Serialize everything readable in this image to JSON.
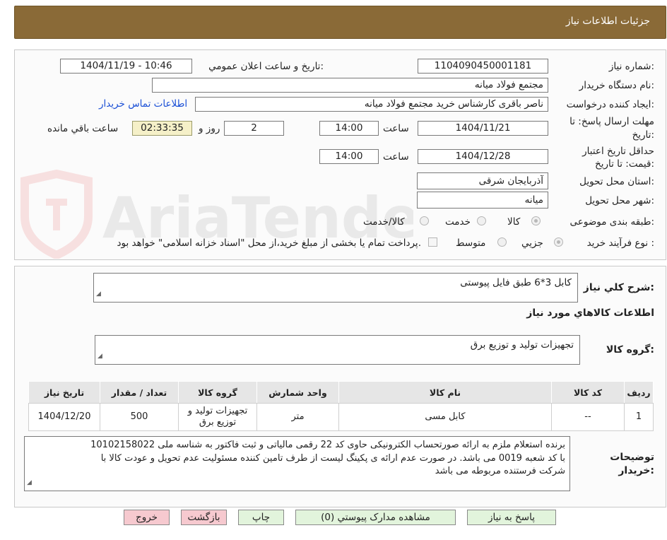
{
  "header": {
    "title": "جزئیات اطلاعات نیاز"
  },
  "watermark": {
    "text": "AriaTender.neT"
  },
  "form": {
    "need_number_label": "شماره نیاز:",
    "need_number": "1104090450001181",
    "announce_label": "تاریخ و ساعت اعلان عمومي:",
    "announce_value": "1404/11/19 - 10:46",
    "buyer_org_label": "نام دستگاه خریدار:",
    "buyer_org": "مجتمع فولاد میانه",
    "requester_label": "ایجاد کننده درخواست:",
    "requester": "ناصر باقری کارشناس خرید مجتمع فولاد میانه",
    "contact_link": "اطلاعات تماس خریدار",
    "deadline_label_1": "مهلت ارسال پاسخ: تا",
    "deadline_label_2": "تاریخ:",
    "deadline_date": "1404/11/21",
    "time_label": "ساعت",
    "deadline_time": "14:00",
    "days_value": "2",
    "days_label": "روز و",
    "timer_value": "02:33:35",
    "remaining_label": "ساعت باقي مانده",
    "validity_label_1": "حداقل تاریخ اعتبار",
    "validity_label_2": "قیمت: تا تاریخ:",
    "validity_date": "1404/12/28",
    "validity_time_label": "ساعت",
    "validity_time": "14:00",
    "province_label": "استان محل تحویل:",
    "province": "آذربایجان شرقی",
    "city_label": "شهر محل تحویل:",
    "city": "میانه",
    "category_label": "طبقه بندی موضوعی:",
    "category_options": [
      "کالا",
      "خدمت",
      "کالا/خدمت"
    ],
    "process_label": "نوع فرآیند خرید :",
    "process_options": [
      "جزیي",
      "متوسط"
    ],
    "payment_note": "پرداخت تمام یا بخشی از مبلغ خرید،از محل \"اسناد خزانه اسلامی\" خواهد بود."
  },
  "summary": {
    "label": "شرح کلي نیاز:",
    "value": "کابل 3*6 طبق فایل پیوستی"
  },
  "goods": {
    "section_title": "اطلاعات کالاهاي مورد نیاز",
    "group_label": "گروه کالا:",
    "group_value": "تجهیزات تولید و توزیع برق"
  },
  "table": {
    "headers": [
      "ردیف",
      "کد کالا",
      "نام کالا",
      "واحد شمارش",
      "گروه کالا",
      "تعداد / مقدار",
      "تاریخ نیاز"
    ],
    "rows": [
      [
        "1",
        "--",
        "کابل مسی",
        "متر",
        "تجهیزات تولید و توزیع برق",
        "500",
        "1404/12/20"
      ]
    ]
  },
  "buyer_notes": {
    "label_1": "توضیحات",
    "label_2": "خریدار:",
    "line_1": "برنده استعلام ملزم به ارائه صورتحساب الکترونیکی حاوی کد 22 رقمی مالیاتی و ثبت فاکتور به شناسه ملی 10102158022",
    "line_2": "با کد شعبه 0019  می باشد.  در صورت عدم ارائه ی پکینگ لیست از طرف تامین کننده مسئولیت عدم تحویل و عودت کالا با",
    "line_3": "شرکت فرستنده مربوطه می باشد"
  },
  "buttons": {
    "reply": "پاسخ به نیاز",
    "view_docs": "مشاهده مدارک پیوستي (0)",
    "print": "چاپ",
    "back": "بازگشت",
    "exit": "خروج"
  }
}
